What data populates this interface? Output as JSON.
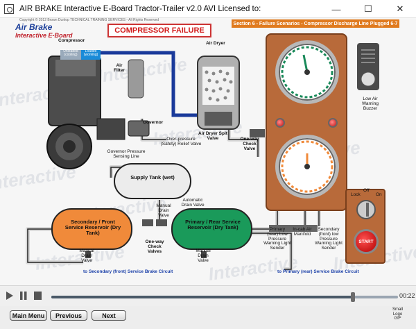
{
  "window": {
    "title": "AIR BRAKE Interactive E-Board Tractor-Trailer  v2.0 AVI    Licensed to:",
    "minimize": "—",
    "maximize": "☐",
    "close": "✕"
  },
  "header": {
    "brand_line1": "Air Brake",
    "brand_line2": "Interactive E-Board",
    "copyright": "Copyright © 2012 Brown Dunlop TECHNICAL TRAINING SERVICES - All Rights Reserved",
    "failure_title": "COMPRESSOR FAILURE",
    "section_banner": "Section 6 - Failure Scenarios - Compressor Discharge Line Plugged 6-7"
  },
  "watermark": "Interactive",
  "diagram": {
    "compressor": "Compressor",
    "unloaded": "Unloaded (cooling)",
    "loaded": "Loaded (working)",
    "air_filter": "Air Filter",
    "air_dryer": "Air Dryer",
    "governor": "Governor",
    "air_dryer_spit_valve": "Air Dryer Spit Valve",
    "one_way_check_valve": "One-way Check Valve",
    "over_pressure_valve": "Over-pressure (Safety) Relief Valve",
    "governor_line": "Governor Pressure Sensing Line",
    "supply_tank": "Supply Tank (wet)",
    "automatic_drain": "Automatic Drain Valve",
    "manual_drain_valve_top": "Manual Drain Valve",
    "secondary_reservoir": "Secondary / Front Service Reservoir (Dry Tank)",
    "primary_reservoir": "Primary / Rear Service Reservoir (Dry Tank)",
    "manual_drain_left": "Manual Drain Valve",
    "one_way_check_valves": "One-way Check Valves",
    "manual_drain_right": "Manual Drain Valve",
    "primary_low_pressure": "Primary (rear) Low Pressure Warning Light Sender",
    "in_cab_manifold": "In-cab Air Manifold",
    "secondary_low_pressure": "Secondary (front) low Pressure Warning Light Sender",
    "low_air_buzzer": "Low Air Warning Buzzer",
    "to_secondary_circuit": "to Secondary (front) Service Brake Circuit",
    "to_primary_circuit": "to Primary (rear) Service Brake Circuit",
    "knob_lock": "Lock",
    "knob_off": "Off",
    "knob_on": "On",
    "start_button": "START"
  },
  "player": {
    "play_icon": "play-icon",
    "pause_icon": "pause-icon",
    "stop_icon": "stop-icon",
    "progress": 0.87,
    "time": "00:22"
  },
  "navigation": {
    "main_menu": "Main Menu",
    "previous": "Previous",
    "next": "Next",
    "small_logo_gif": "Small\nLogo\nGIF"
  },
  "colors": {
    "failure_red": "#d21a1a",
    "banner_orange": "#e07b1f",
    "supply_line_blue": "#1a3a9a",
    "primary_green": "#1a9a5a",
    "secondary_orange": "#f08a3a",
    "link_blue": "#1a3fa8"
  }
}
